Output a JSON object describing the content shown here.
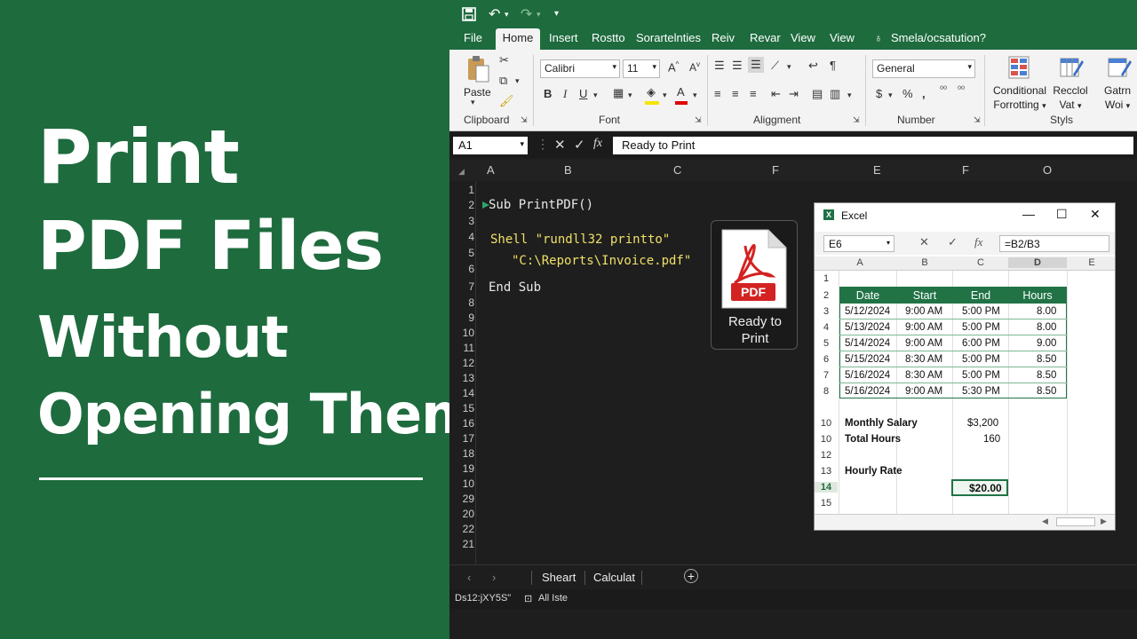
{
  "banner": {
    "line1": "Print",
    "line2": "PDF Files",
    "line3": "Without",
    "line4": "Opening Them",
    "bg_color": "#1e6b3e"
  },
  "menu": {
    "tabs": [
      "File",
      "Home",
      "Insert",
      "Rostto",
      "Sorartelnties",
      "Reiv",
      "Revar",
      "View",
      "View"
    ],
    "search": "Smela/ocsatution?"
  },
  "ribbon": {
    "paste_label": "Paste",
    "clipboard_label": "Clipboard",
    "font_name": "Calibri",
    "font_size": "11",
    "font_group_label": "Font",
    "alignment_label": "Aliggment",
    "number_format": "General",
    "number_label": "Number",
    "conditional_line1": "Conditional",
    "conditional_line2": "Forrotting",
    "recclol_line1": "Recclol",
    "recclol_line2": "Vat",
    "gatrn_line1": "Gatrn",
    "gatrn_line2": "Woi",
    "styles_label": "Styls"
  },
  "formula_bar": {
    "name_box": "A1",
    "fx": "fx",
    "content": "Ready to Print"
  },
  "columns": [
    "A",
    "B",
    "C",
    "F",
    "E",
    "F",
    "O"
  ],
  "rows": [
    "1",
    "2",
    "3",
    "4",
    "5",
    "6",
    "7",
    "8",
    "9",
    "10",
    "11",
    "12",
    "13",
    "14",
    "15",
    "16",
    "17",
    "18",
    "19",
    "10",
    "29",
    "20",
    "22",
    "21"
  ],
  "vba": {
    "line1": "Sub PrintPDF()",
    "line2": "Shell \"rundll32 printto\"",
    "line3": "\"C:\\Reports\\Invoice.pdf\"",
    "line4": "End Sub"
  },
  "pdf_card": {
    "icon_text": "PDF",
    "label": "Ready to\nPrint"
  },
  "popup": {
    "title": "Excel",
    "name_box": "E6",
    "formula": "=B2/B3",
    "columns": [
      "A",
      "B",
      "C",
      "D",
      "E"
    ],
    "row_numbers": [
      "1",
      "2",
      "3",
      "4",
      "5",
      "6",
      "7",
      "8",
      "10",
      "10",
      "12",
      "13",
      "14",
      "15"
    ],
    "headers": [
      "Date",
      "Start",
      "End",
      "Hours"
    ],
    "rows": [
      [
        "5/12/2024",
        "9:00 AM",
        "5:00 PM",
        "8.00"
      ],
      [
        "5/13/2024",
        "9:00 AM",
        "5:00 PM",
        "8.00"
      ],
      [
        "5/14/2024",
        "9:00 AM",
        "6:00 PM",
        "9.00"
      ],
      [
        "5/15/2024",
        "8:30 AM",
        "5:00 PM",
        "8.50"
      ],
      [
        "5/16/2024",
        "8:30 AM",
        "5:00 PM",
        "8.50"
      ],
      [
        "5/16/2024",
        "9:00 AM",
        "5:30 PM",
        "8.50"
      ]
    ],
    "monthly_salary_label": "Monthly Salary",
    "monthly_salary": "$3,200",
    "total_hours_label": "Total Hours",
    "total_hours": "160",
    "hourly_rate_label": "Hourly Rate",
    "hourly_rate": "$20.00",
    "header_color": "#217346"
  },
  "sheets": {
    "tab1": "Sheart",
    "tab2": "Calculat"
  },
  "status": {
    "left": "Ds12:jXY5S\"",
    "right": "All Iste"
  }
}
